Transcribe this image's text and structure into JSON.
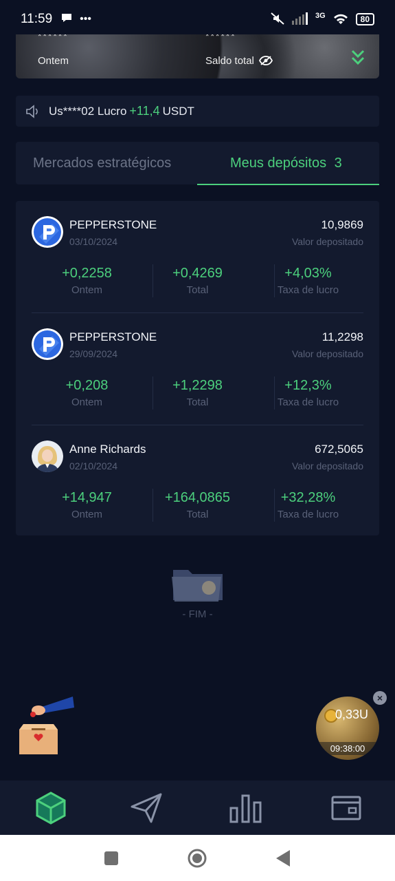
{
  "status_bar": {
    "time": "11:59",
    "network": "3G",
    "battery": "80"
  },
  "banner": {
    "masked_left": "******",
    "masked_right": "******",
    "label_yesterday": "Ontem",
    "label_total_balance": "Saldo total"
  },
  "ticker": {
    "user": "Us****02 Lucro",
    "amount": "+11,4",
    "currency": "USDT"
  },
  "tabs": [
    {
      "label": "Mercados estratégicos",
      "active": false
    },
    {
      "label": "Meus depósitos",
      "count": "3",
      "active": true
    }
  ],
  "deposits": [
    {
      "name": "PEPPERSTONE",
      "date": "03/10/2024",
      "amount": "10,9869",
      "amount_label": "Valor depositado",
      "yesterday": "+0,2258",
      "total": "+0,4269",
      "rate": "+4,03%",
      "logo": "pepperstone-logo"
    },
    {
      "name": "PEPPERSTONE",
      "date": "29/09/2024",
      "amount": "11,2298",
      "amount_label": "Valor depositado",
      "yesterday": "+0,208",
      "total": "+1,2298",
      "rate": "+12,3%",
      "logo": "pepperstone-logo"
    },
    {
      "name": "Anne Richards",
      "date": "02/10/2024",
      "amount": "672,5065",
      "amount_label": "Valor depositado",
      "yesterday": "+14,947",
      "total": "+164,0865",
      "rate": "+32,28%",
      "logo": "person-avatar"
    }
  ],
  "stat_labels": {
    "yesterday": "Ontem",
    "total": "Total",
    "rate": "Taxa de lucro"
  },
  "end_text": "- FIM -",
  "float_widget": {
    "amount": "0,33U",
    "timer": "09:38:00"
  },
  "colors": {
    "background": "#0b1123",
    "card": "#131a2e",
    "accent_green": "#4cd07d",
    "muted": "#596178"
  }
}
